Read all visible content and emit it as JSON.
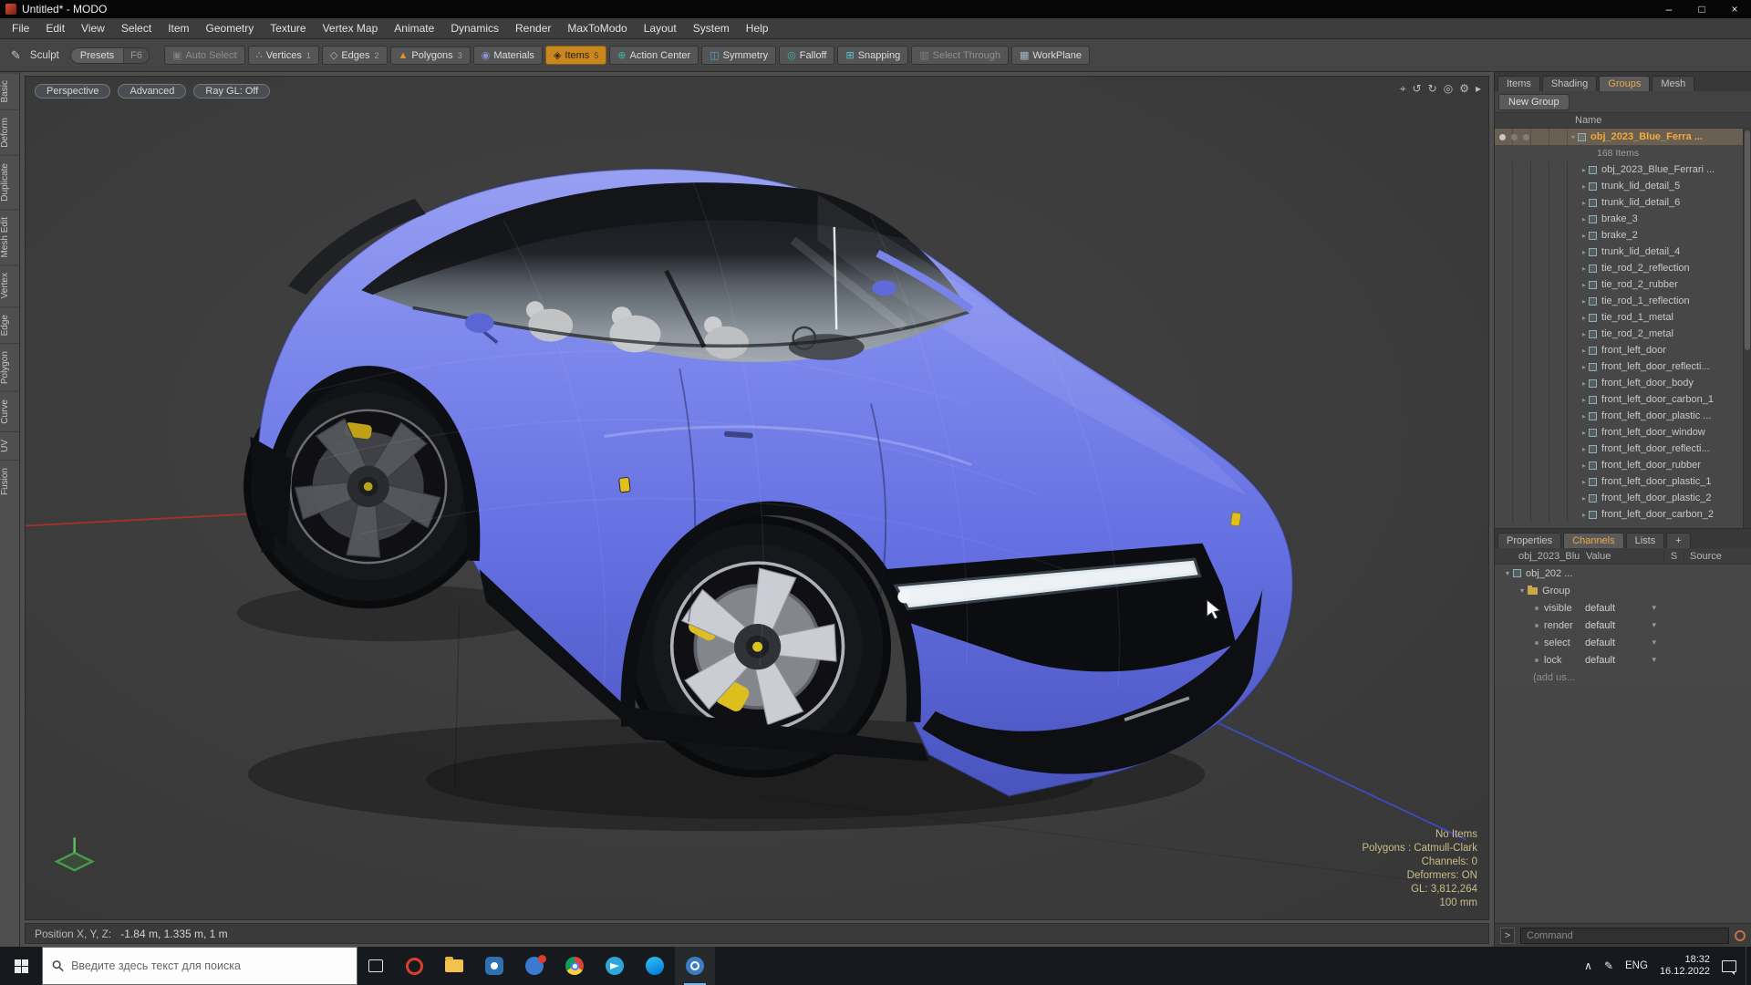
{
  "window": {
    "title": "Untitled* - MODO",
    "minimize": "–",
    "maximize": "□",
    "close": "×"
  },
  "menu": [
    "File",
    "Edit",
    "View",
    "Select",
    "Item",
    "Geometry",
    "Texture",
    "Vertex Map",
    "Animate",
    "Dynamics",
    "Render",
    "MaxToModo",
    "Layout",
    "System",
    "Help"
  ],
  "toolbar": {
    "sculpt": "Sculpt",
    "sculpt_glyph": "✎",
    "presets": "Presets",
    "presets_key": "F6",
    "modes": [
      {
        "label": "Auto Select",
        "glyph": "▣",
        "cls": "dim"
      },
      {
        "label": "Vertices",
        "glyph": "∴",
        "key": "1"
      },
      {
        "label": "Edges",
        "glyph": "◇",
        "key": "2"
      },
      {
        "label": "Polygons",
        "glyph": "▲",
        "key": "3",
        "cls": "c-orange"
      },
      {
        "label": "Materials",
        "glyph": "◉",
        "cls": "c-purple"
      },
      {
        "label": "Items",
        "glyph": "◈",
        "key": "5",
        "cls": "active"
      },
      {
        "label": "Action Center",
        "glyph": "⊕",
        "cls": "c-teal"
      },
      {
        "label": "Symmetry",
        "glyph": "◫",
        "cls": "c-blue"
      },
      {
        "label": "Falloff",
        "glyph": "◎",
        "cls": "c-teal"
      },
      {
        "label": "Snapping",
        "glyph": "⊞",
        "cls": "c-cyan"
      },
      {
        "label": "Select Through",
        "glyph": "▥",
        "cls": "dim"
      },
      {
        "label": "WorkPlane",
        "glyph": "▦"
      }
    ]
  },
  "left_tabs": [
    "Basic",
    "Deform",
    "Duplicate",
    "Mesh Edit",
    "Vertex",
    "Edge",
    "Polygon",
    "Curve",
    "UV",
    "Fusion"
  ],
  "viewport": {
    "pills": [
      "Perspective",
      "Advanced",
      "Ray GL: Off"
    ],
    "icons": [
      {
        "name": "target-icon",
        "glyph": "⌖"
      },
      {
        "name": "orbit-ccw-icon",
        "glyph": "↺"
      },
      {
        "name": "orbit-cw-icon",
        "glyph": "↻"
      },
      {
        "name": "shading-icon",
        "glyph": "◎"
      },
      {
        "name": "viewport-settings-icon",
        "glyph": "⚙"
      },
      {
        "name": "collapse-arrow-icon",
        "glyph": "▸"
      }
    ],
    "stats": [
      "No Items",
      "Polygons : Catmull-Clark",
      "Channels: 0",
      "Deformers: ON",
      "GL: 3,812,264",
      "100 mm"
    ],
    "position_label": "Position X, Y, Z:",
    "position_value": "-1.84 m, 1.335 m, 1 m"
  },
  "groups_panel": {
    "tabs": [
      {
        "label": "Items"
      },
      {
        "label": "Shading"
      },
      {
        "label": "Groups",
        "cls": "active"
      },
      {
        "label": "Mesh"
      }
    ],
    "more_icon": "⊞",
    "arrow_icon": "▾",
    "new_group": "New Group",
    "name_header": "Name",
    "selected_item": {
      "label": "obj_2023_Blue_Ferra ...",
      "count": "168 Items"
    },
    "items": [
      "obj_2023_Blue_Ferrari ...",
      "trunk_lid_detail_5",
      "trunk_lid_detail_6",
      "brake_3",
      "brake_2",
      "trunk_lid_detail_4",
      "tie_rod_2_reflection",
      "tie_rod_2_rubber",
      "tie_rod_1_reflection",
      "tie_rod_1_metal",
      "tie_rod_2_metal",
      "front_left_door",
      "front_left_door_reflecti...",
      "front_left_door_body",
      "front_left_door_carbon_1",
      "front_left_door_plastic ...",
      "front_left_door_window",
      "front_left_door_reflecti...",
      "front_left_door_rubber",
      "front_left_door_plastic_1",
      "front_left_door_plastic_2",
      "front_left_door_carbon_2"
    ]
  },
  "channels_panel": {
    "tabs": [
      {
        "label": "Properties"
      },
      {
        "label": "Channels",
        "cls": "active"
      },
      {
        "label": "Lists"
      },
      {
        "label": "+"
      }
    ],
    "header": {
      "name": "obj_2023_Blu ...",
      "value": "Value",
      "s": "S",
      "source": "Source"
    },
    "tree_root": "obj_202 ...",
    "tree_group": "Group",
    "channels": [
      {
        "name": "visible",
        "value": "default"
      },
      {
        "name": "render",
        "value": "default"
      },
      {
        "name": "select",
        "value": "default"
      },
      {
        "name": "lock",
        "value": "default"
      }
    ],
    "add_user": "(add us...",
    "prompt": ">",
    "command_placeholder": "Command"
  },
  "taskbar": {
    "search_placeholder": "Введите здесь текст для поиска",
    "tray": {
      "chevron": "∧",
      "pen": "✎",
      "lang": "ENG",
      "time": "18:32",
      "date": "16.12.2022"
    }
  },
  "colors": {
    "accent_orange": "#e8962e",
    "selected_text": "#f2a93d",
    "body_blue": "#6b77e8",
    "caliper_yellow": "#ddbe1f",
    "drl_white": "#eef2f6",
    "axis_red": "#a83228",
    "axis_blue": "#3c4cc0"
  }
}
